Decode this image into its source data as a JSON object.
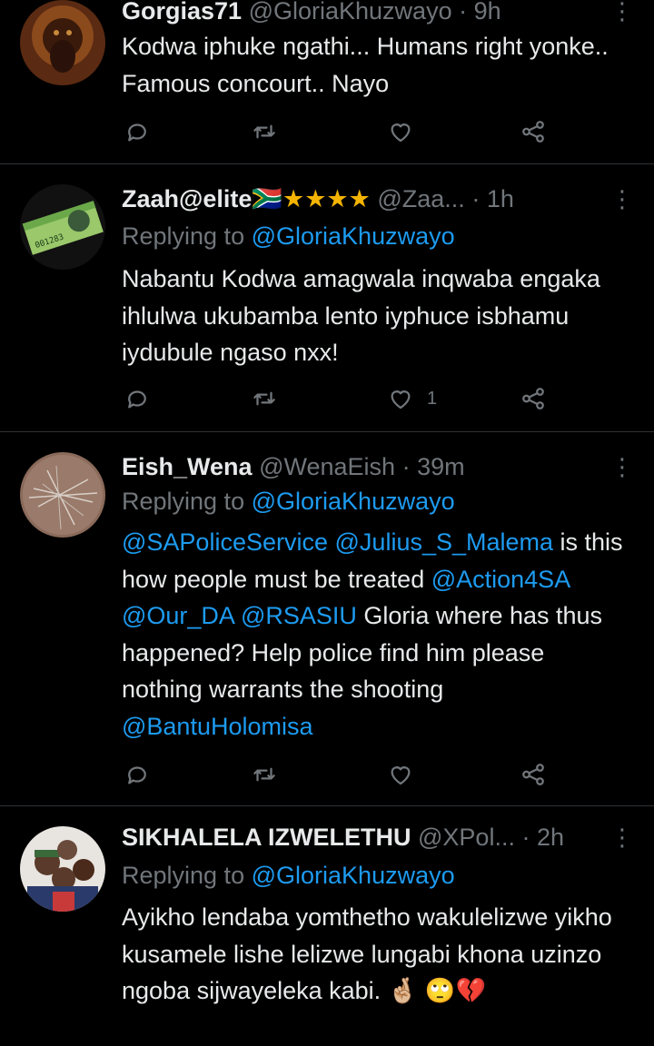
{
  "tweets": [
    {
      "name": "Gorgias71",
      "handle": "@GloriaKhuzwayo",
      "sep": "·",
      "time": "9h",
      "body_plain": "Kodwa iphuke ngathi... Humans right yonke.. Famous concourt.. Nayo",
      "likes": ""
    },
    {
      "name": "Zaah@elite",
      "flag_emoji": "🇿🇦",
      "stars": "★★★★",
      "handle": "@Zaa...",
      "sep": "·",
      "time": "1h",
      "replying_prefix": "Replying to",
      "replying_to": "@GloriaKhuzwayo",
      "body_plain": "Nabantu Kodwa amagwala inqwaba engaka ihlulwa ukubamba lento iyphuce isbhamu iydubule ngaso nxx!",
      "likes": "1"
    },
    {
      "name": "Eish_Wena",
      "handle": "@WenaEish",
      "sep": "·",
      "time": "39m",
      "replying_prefix": "Replying to",
      "replying_to": "@GloriaKhuzwayo",
      "body_parts": {
        "m1": "@SAPoliceService",
        "m2": "@Julius_S_Malema",
        "t1": " is this how people must be treated ",
        "m3": "@Action4SA",
        "m4": "@Our_DA",
        "m5": "@RSASIU",
        "t2": " Gloria where has thus happened? Help police find him please nothing warrants the shooting ",
        "m6": "@BantuHolomisa"
      },
      "likes": ""
    },
    {
      "name": "SIKHALELA IZWELETHU",
      "handle": "@XPol...",
      "sep": "·",
      "time": "2h",
      "replying_prefix": "Replying to",
      "replying_to": "@GloriaKhuzwayo",
      "body_plain": "Ayikho lendaba yomthetho wakulelizwe yikho kusamele lishe lelizwe lungabi khona uzinzo ngoba sijwayeleka kabi.",
      "emojis": "🤞🏼 🙄💔"
    }
  ],
  "icons": {
    "reply": "reply-icon",
    "retweet": "retweet-icon",
    "like": "heart-icon",
    "share": "share-icon",
    "more": "more-icon"
  },
  "colors": {
    "background": "#000000",
    "text": "#e7e9ea",
    "secondary": "#71767b",
    "accent": "#1d9bf0",
    "divider": "#2f3336"
  }
}
